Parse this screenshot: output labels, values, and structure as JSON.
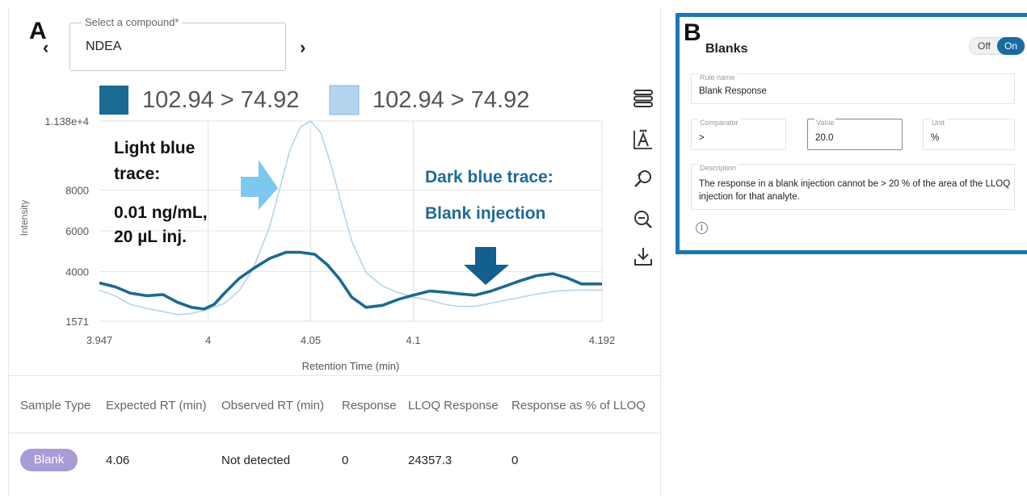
{
  "panel_a": {
    "letter": "A",
    "compound_select": {
      "legend": "Select a compound*",
      "value": "NDEA",
      "prev_icon": "chevron-left-icon",
      "next_icon": "chevron-right-icon"
    },
    "legend": [
      {
        "label": "102.94 > 74.92",
        "color": "#1b6a92"
      },
      {
        "label": "102.94 > 74.92",
        "color": "#b3d4ee"
      }
    ],
    "toolbar": [
      "layers-icon",
      "auto-scale-icon",
      "reset-zoom-icon",
      "zoom-out-icon",
      "download-icon"
    ],
    "annotations": {
      "light_label_1": "Light blue",
      "light_label_2": "trace:",
      "light_label_3": "0.01 ng/mL,",
      "light_label_4": "20 µL inj.",
      "dark_label_1": "Dark blue trace:",
      "dark_label_2": "Blank injection"
    },
    "results_table": {
      "headers": [
        "Sample Type",
        "Expected RT (min)",
        "Observed RT (min)",
        "Response",
        "LLOQ Response",
        "Response as % of LLOQ"
      ],
      "row": {
        "sample_type": "Blank",
        "expected_rt": "4.06",
        "observed_rt": "Not detected",
        "response": "0",
        "lloq_response": "24357.3",
        "response_pct": "0"
      }
    }
  },
  "chart_data": {
    "type": "line",
    "title": "",
    "xlabel": "Retention Time (min)",
    "ylabel": "Intensity",
    "xlim": [
      3.947,
      4.192
    ],
    "ylim": [
      1571,
      11380
    ],
    "x_ticks": [
      "3.947",
      "4",
      "4.05",
      "4.1",
      "4.192"
    ],
    "x_tick_values": [
      3.947,
      4.0,
      4.05,
      4.1,
      4.192
    ],
    "y_ticks": [
      "1.138e+4",
      "8000",
      "6000",
      "4000",
      "1571"
    ],
    "y_tick_values": [
      11380,
      8000,
      6000,
      4000,
      1571
    ],
    "grid": true,
    "colors": {
      "dark": "#1b6a92",
      "light": "#b3d4ee",
      "arrow_light": "#7cc8ef",
      "arrow_dark": "#135f8f",
      "dark_text": "#1f6a96"
    },
    "series": [
      {
        "name": "102.94 > 74.92",
        "color": "#1b6a92",
        "x": [
          3.947,
          3.955,
          3.962,
          3.97,
          3.978,
          3.985,
          3.992,
          3.998,
          4.003,
          4.008,
          4.015,
          4.022,
          4.03,
          4.038,
          4.045,
          4.052,
          4.058,
          4.064,
          4.07,
          4.077,
          4.085,
          4.093,
          4.1,
          4.108,
          4.115,
          4.122,
          4.13,
          4.138,
          4.145,
          4.152,
          4.16,
          4.168,
          4.175,
          4.182,
          4.192
        ],
        "y": [
          3450,
          3250,
          2950,
          2820,
          2880,
          2500,
          2250,
          2170,
          2400,
          2950,
          3650,
          4150,
          4650,
          4950,
          4950,
          4850,
          4350,
          3650,
          2750,
          2250,
          2350,
          2650,
          2850,
          3050,
          3000,
          2920,
          2850,
          3050,
          3300,
          3550,
          3800,
          3900,
          3700,
          3400,
          3400
        ]
      },
      {
        "name": "102.94 > 74.92",
        "color": "#b3d4ee",
        "x": [
          3.947,
          3.955,
          3.962,
          3.97,
          3.978,
          3.985,
          3.992,
          4.0,
          4.008,
          4.015,
          4.022,
          4.03,
          4.035,
          4.04,
          4.045,
          4.05,
          4.055,
          4.06,
          4.065,
          4.07,
          4.077,
          4.085,
          4.092,
          4.1,
          4.108,
          4.115,
          4.122,
          4.13,
          4.14,
          4.15,
          4.16,
          4.17,
          4.18,
          4.192
        ],
        "y": [
          3100,
          2800,
          2400,
          2200,
          2050,
          1900,
          1950,
          2150,
          2450,
          3050,
          4150,
          6200,
          8100,
          10000,
          11100,
          11380,
          10800,
          9200,
          7300,
          5500,
          3950,
          3300,
          3000,
          2750,
          2600,
          2400,
          2300,
          2300,
          2500,
          2700,
          2900,
          3050,
          3100,
          3100
        ]
      }
    ]
  },
  "panel_b": {
    "letter": "B",
    "title": "Blanks",
    "toggle": {
      "off": "Off",
      "on": "On"
    },
    "rule_name": {
      "label": "Rule name",
      "value": "Blank Response"
    },
    "comparator": {
      "label": "Comparator",
      "value": ">"
    },
    "value": {
      "label": "Value",
      "value": "20.0"
    },
    "unit": {
      "label": "Unit",
      "value": "%"
    },
    "description": {
      "label": "Description",
      "value": "The response in a blank injection cannot be > 20 % of the area of the LLOQ injection for that analyte."
    },
    "info_icon": "info-icon",
    "info_glyph": "i"
  }
}
